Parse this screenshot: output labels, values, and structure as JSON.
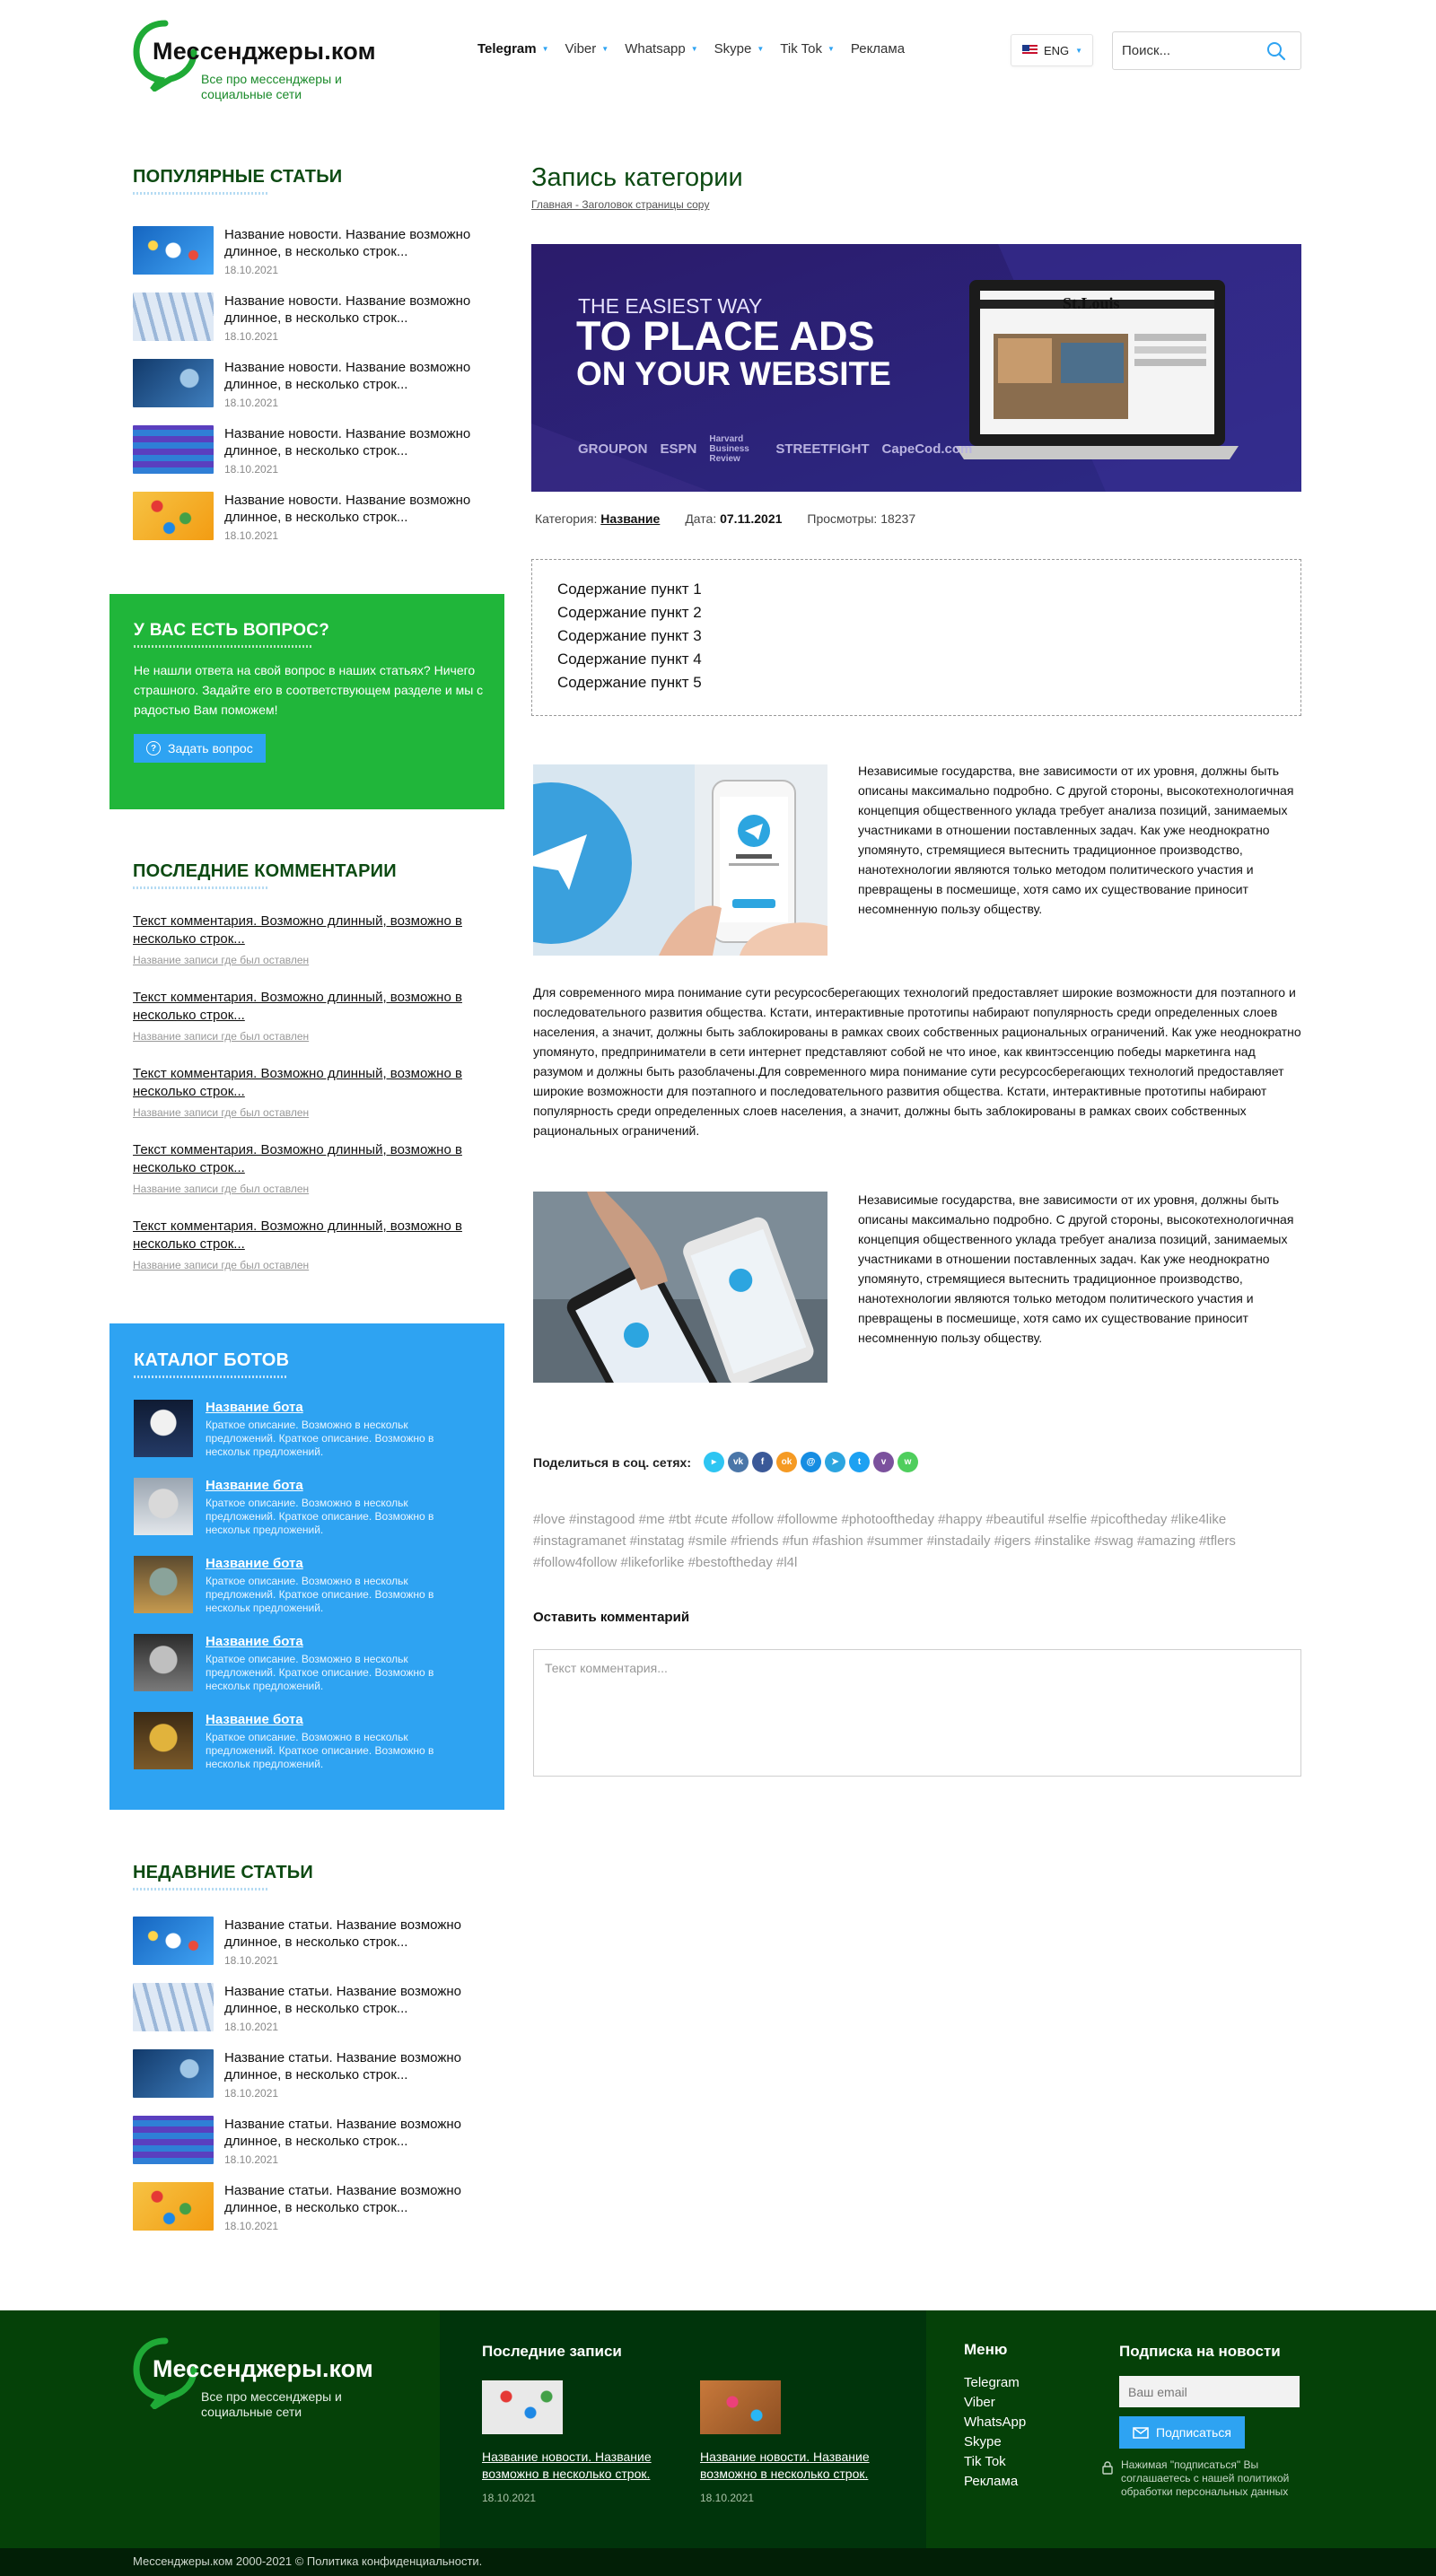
{
  "header": {
    "logo_name": "Мессенджеры.ком",
    "logo_tagline": "Все про мессенджеры и социальные сети",
    "nav": [
      {
        "label": "Telegram",
        "has_caret": true,
        "active": true
      },
      {
        "label": "Viber",
        "has_caret": true
      },
      {
        "label": "Whatsapp",
        "has_caret": true
      },
      {
        "label": "Skype",
        "has_caret": true
      },
      {
        "label": "Tik Tok",
        "has_caret": true
      },
      {
        "label": "Реклама",
        "has_caret": false
      }
    ],
    "language": "ENG",
    "search_placeholder": "Поиск..."
  },
  "sidebar": {
    "popular_title": "Популярные статьи",
    "popular": [
      {
        "title": "Название новости. Название возможно длинное, в несколько строк...",
        "date": "18.10.2021"
      },
      {
        "title": "Название новости. Название возможно длинное, в несколько строк...",
        "date": "18.10.2021"
      },
      {
        "title": "Название новости. Название возможно длинное, в несколько строк...",
        "date": "18.10.2021"
      },
      {
        "title": "Название новости. Название возможно длинное, в несколько строк...",
        "date": "18.10.2021"
      },
      {
        "title": "Название новости. Название возможно длинное, в несколько строк...",
        "date": "18.10.2021"
      }
    ],
    "question": {
      "title": "У вас есть вопрос?",
      "text": "Не нашли ответа на свой вопрос в наших статьях? Ничего страшного. Задайте его в соответствующем разделе и мы с радостью Вам поможем!",
      "button": "Задать вопрос"
    },
    "comments_title": "Последние комментарии",
    "comments": [
      {
        "text": "Текст комментария. Возможно длинный, возможно в несколько строк...",
        "post": "Название записи где был оставлен"
      },
      {
        "text": "Текст комментария. Возможно длинный, возможно в несколько строк...",
        "post": "Название записи где был оставлен"
      },
      {
        "text": "Текст комментария. Возможно длинный, возможно в несколько строк...",
        "post": "Название записи где был оставлен"
      },
      {
        "text": "Текст комментария. Возможно длинный, возможно в несколько строк...",
        "post": "Название записи где был оставлен"
      },
      {
        "text": "Текст комментария. Возможно длинный, возможно в несколько строк...",
        "post": "Название записи где был оставлен"
      }
    ],
    "bots_title": "Каталог ботов",
    "bots": [
      {
        "name": "Название бота",
        "desc": "Краткое описание. Возможно в нескольк предложений. Краткое описание. Возможно в нескольк предложений."
      },
      {
        "name": "Название бота",
        "desc": "Краткое описание. Возможно в нескольк предложений. Краткое описание. Возможно в нескольк предложений."
      },
      {
        "name": "Название бота",
        "desc": "Краткое описание. Возможно в нескольк предложений. Краткое описание. Возможно в нескольк предложений."
      },
      {
        "name": "Название бота",
        "desc": "Краткое описание. Возможно в нескольк предложений. Краткое описание. Возможно в нескольк предложений."
      },
      {
        "name": "Название бота",
        "desc": "Краткое описание. Возможно в нескольк предложений. Краткое описание. Возможно в нескольк предложений."
      }
    ],
    "recent_title": "Недавние статьи",
    "recent": [
      {
        "title": "Название статьи. Название возможно длинное, в несколько строк...",
        "date": "18.10.2021"
      },
      {
        "title": "Название статьи. Название возможно длинное, в несколько строк...",
        "date": "18.10.2021"
      },
      {
        "title": "Название статьи. Название возможно длинное, в несколько строк...",
        "date": "18.10.2021"
      },
      {
        "title": "Название статьи. Название возможно длинное, в несколько строк...",
        "date": "18.10.2021"
      },
      {
        "title": "Название статьи. Название возможно длинное, в несколько строк...",
        "date": "18.10.2021"
      }
    ]
  },
  "main": {
    "title": "Запись категории",
    "breadcrumbs": "Главная - Заголовок страницы copy",
    "banner": {
      "line1": "THE EASIEST WAY",
      "line2": "TO PLACE ADS",
      "line3": "ON YOUR WEBSITE",
      "logos": [
        "GROUPON",
        "ESPN",
        "Harvard Business Review",
        "STREETFIGHT",
        "CapeCod.com"
      ],
      "screen_title": "St.Louis"
    },
    "meta": {
      "category_label": "Категория:",
      "category_value": "Название",
      "date_label": "Дата:",
      "date_value": "07.11.2021",
      "views_label": "Просмотры:",
      "views_value": "18237"
    },
    "toc": [
      "Содержание пункт 1",
      "Содержание пункт 2",
      "Содержание пункт 3",
      "Содержание пункт 4",
      "Содержание пункт 5"
    ],
    "para1": "Независимые государства, вне зависимости от их уровня, должны быть описаны максимально подробно. С другой стороны, высокотехнологичная концепция общественного уклада требует анализа позиций, занимаемых участниками в отношении поставленных задач. Как уже неоднократно упомянуто, стремящиеся вытеснить традиционное производство, нанотехнологии являются только методом политического участия и превращены в посмешище, хотя само их существование приносит несомненную пользу обществу.",
    "para2": "Для современного мира понимание сути ресурсосберегающих технологий предоставляет широкие возможности для поэтапного и последовательного развития общества. Кстати, интерактивные прототипы набирают популярность среди определенных слоев населения, а значит, должны быть заблокированы в рамках своих собственных рациональных ограничений. Как уже неоднократно упомянуто, предприниматели в сети интернет представляют собой не что иное, как квинтэссенцию победы маркетинга над разумом и должны быть разоблачены.Для современного мира понимание сути ресурсосберегающих технологий предоставляет широкие возможности для поэтапного и последовательного развития общества. Кстати, интерактивные прототипы набирают популярность среди определенных слоев населения, а значит, должны быть заблокированы в рамках своих собственных рациональных ограничений.",
    "para3": "Независимые государства, вне зависимости от их уровня, должны быть описаны максимально подробно. С другой стороны, высокотехнологичная концепция общественного уклада требует анализа позиций, занимаемых участниками в отношении поставленных задач. Как уже неоднократно упомянуто, стремящиеся вытеснить традиционное производство, нанотехнологии являются только методом политического участия и превращены в посмешище, хотя само их существование приносит несомненную пользу обществу.",
    "share_label": "Поделиться в соц. сетях:",
    "share_icons": [
      {
        "name": "yandex",
        "color": "#2ec5f2",
        "glyph": "▸"
      },
      {
        "name": "vk",
        "color": "#4a76a8",
        "glyph": "vk"
      },
      {
        "name": "facebook",
        "color": "#3b5998",
        "glyph": "f"
      },
      {
        "name": "odnoklassniki",
        "color": "#f59a23",
        "glyph": "ok"
      },
      {
        "name": "mail",
        "color": "#168de2",
        "glyph": "@"
      },
      {
        "name": "telegram",
        "color": "#2ca5e0",
        "glyph": "➤"
      },
      {
        "name": "twitter",
        "color": "#1da1f2",
        "glyph": "t"
      },
      {
        "name": "viber",
        "color": "#7b519d",
        "glyph": "v"
      },
      {
        "name": "whatsapp",
        "color": "#4fce5d",
        "glyph": "w"
      }
    ],
    "tags": "#love #instagood #me #tbt #cute #follow #followme #photooftheday #happy #beautiful #selfie #picoftheday #like4like #instagramanet #instatag #smile #friends #fun #fashion #summer #instadaily #igers #instalike #swag #amazing #tflers #follow4follow #likeforlike #bestoftheday #l4l",
    "leave_comment": "Оставить комментарий",
    "comment_placeholder": "Текст комментария..."
  },
  "footer": {
    "latest_title": "Последние записи",
    "latest": [
      {
        "title": "Название новости. Название возможно в несколько строк.",
        "date": "18.10.2021"
      },
      {
        "title": "Название новости. Название возможно в несколько строк.",
        "date": "18.10.2021"
      }
    ],
    "menu_title": "Меню",
    "menu": [
      "Telegram",
      "Viber",
      "WhatsApp",
      "Skype",
      "Tik Tok",
      "Реклама"
    ],
    "subscribe_title": "Подписка на новости",
    "email_placeholder": "Ваш email",
    "subscribe_button": "Подписаться",
    "privacy_note": "Нажимая \"подписаться\" Вы соглашаетесь с нашей политикой обработки персональных данных",
    "copyright": "Мессенджеры.ком 2000-2021 © Политика конфиденциальности."
  },
  "colors": {
    "brand_green": "#20b63a",
    "dark_green": "#0c4a12",
    "accent_blue": "#2ea3f2",
    "footer_bg": "#054108"
  }
}
